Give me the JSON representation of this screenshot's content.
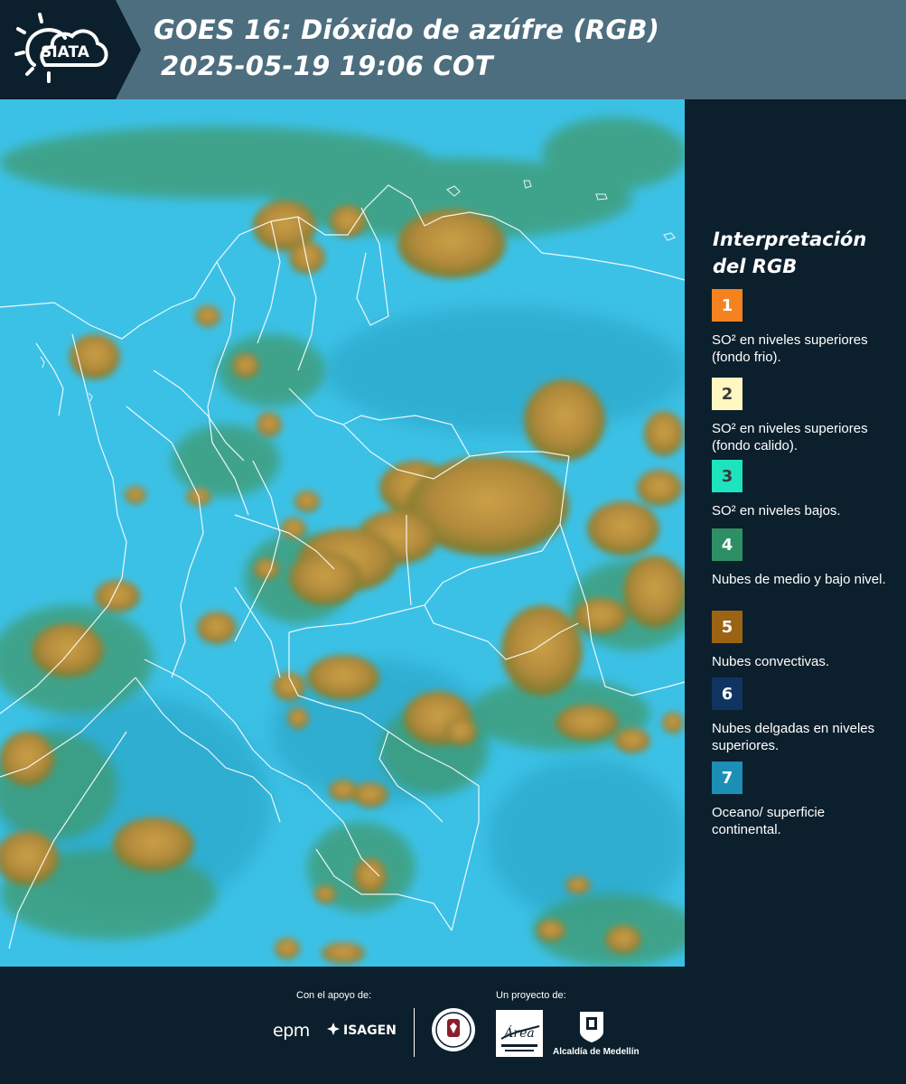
{
  "header": {
    "title_line1": "GOES 16: Dióxido de azúfre (RGB)",
    "title_line2": "2025-05-19 19:06 COT",
    "logo_text": "SIATA",
    "logo_icon": "sun-cloud-icon"
  },
  "map": {
    "layer": "GOES 16 SO2 RGB composite over Colombia",
    "colors": {
      "ocean_land": "#38bfe6",
      "convective_clouds": "#b88d3e",
      "mid_low_clouds": "#3f9a6e",
      "borders": "#ffffff"
    }
  },
  "legend": {
    "title": "Interpretación del RGB",
    "items": [
      {
        "num": "1",
        "color": "#f5821f",
        "text_color": "#ffffff",
        "label": "SO² en niveles superiores (fondo frio)."
      },
      {
        "num": "2",
        "color": "#fff7c2",
        "text_color": "#3a3a3a",
        "label": "SO² en niveles superiores (fondo calido)."
      },
      {
        "num": "3",
        "color": "#1ee3bf",
        "text_color": "#3a3a3a",
        "label": "SO² en niveles bajos."
      },
      {
        "num": "4",
        "color": "#2f8f64",
        "text_color": "#ffffff",
        "label": "Nubes de medio y bajo nivel."
      },
      {
        "num": "5",
        "color": "#9a6414",
        "text_color": "#ffffff",
        "label": "Nubes convectivas."
      },
      {
        "num": "6",
        "color": "#103461",
        "text_color": "#ffffff",
        "label": "Nubes delgadas en niveles superiores."
      },
      {
        "num": "7",
        "color": "#1d8eb5",
        "text_color": "#ffffff",
        "label": "Oceano/ superficie continental."
      }
    ]
  },
  "footer": {
    "support_caption": "Con el apoyo de:",
    "project_caption": "Un proyecto de:",
    "epm": "epm",
    "isagen": "ISAGEN",
    "area_metropolitana": "Área",
    "alcaldia": "Alcaldía de Medellín"
  }
}
